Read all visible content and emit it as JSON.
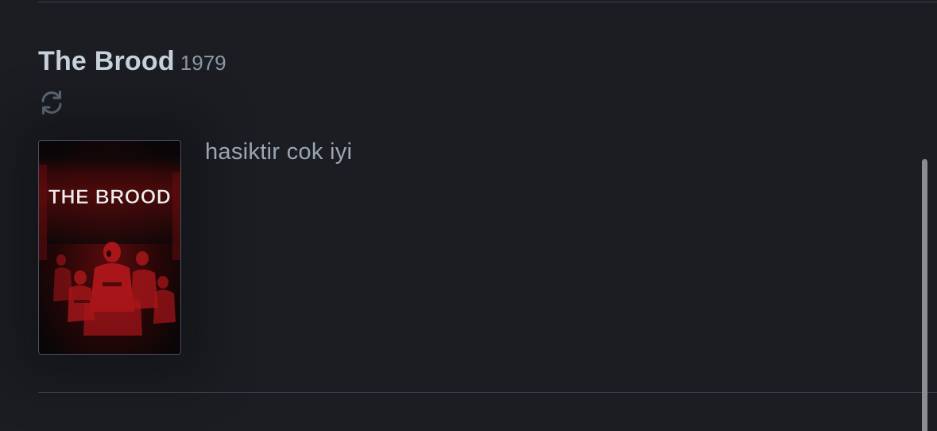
{
  "entry": {
    "title": "The Brood",
    "year": "1979",
    "rewatch_icon": "rewatch-icon",
    "poster": {
      "title_text": "THE BROOD"
    },
    "review": "hasiktir cok iyi"
  },
  "colors": {
    "background": "#1b1d22",
    "title": "#c7d1dc",
    "year": "#8b97a5",
    "review_text": "#9aa6b4",
    "divider": "#3a3f48",
    "poster_red": "#b01a1a"
  }
}
